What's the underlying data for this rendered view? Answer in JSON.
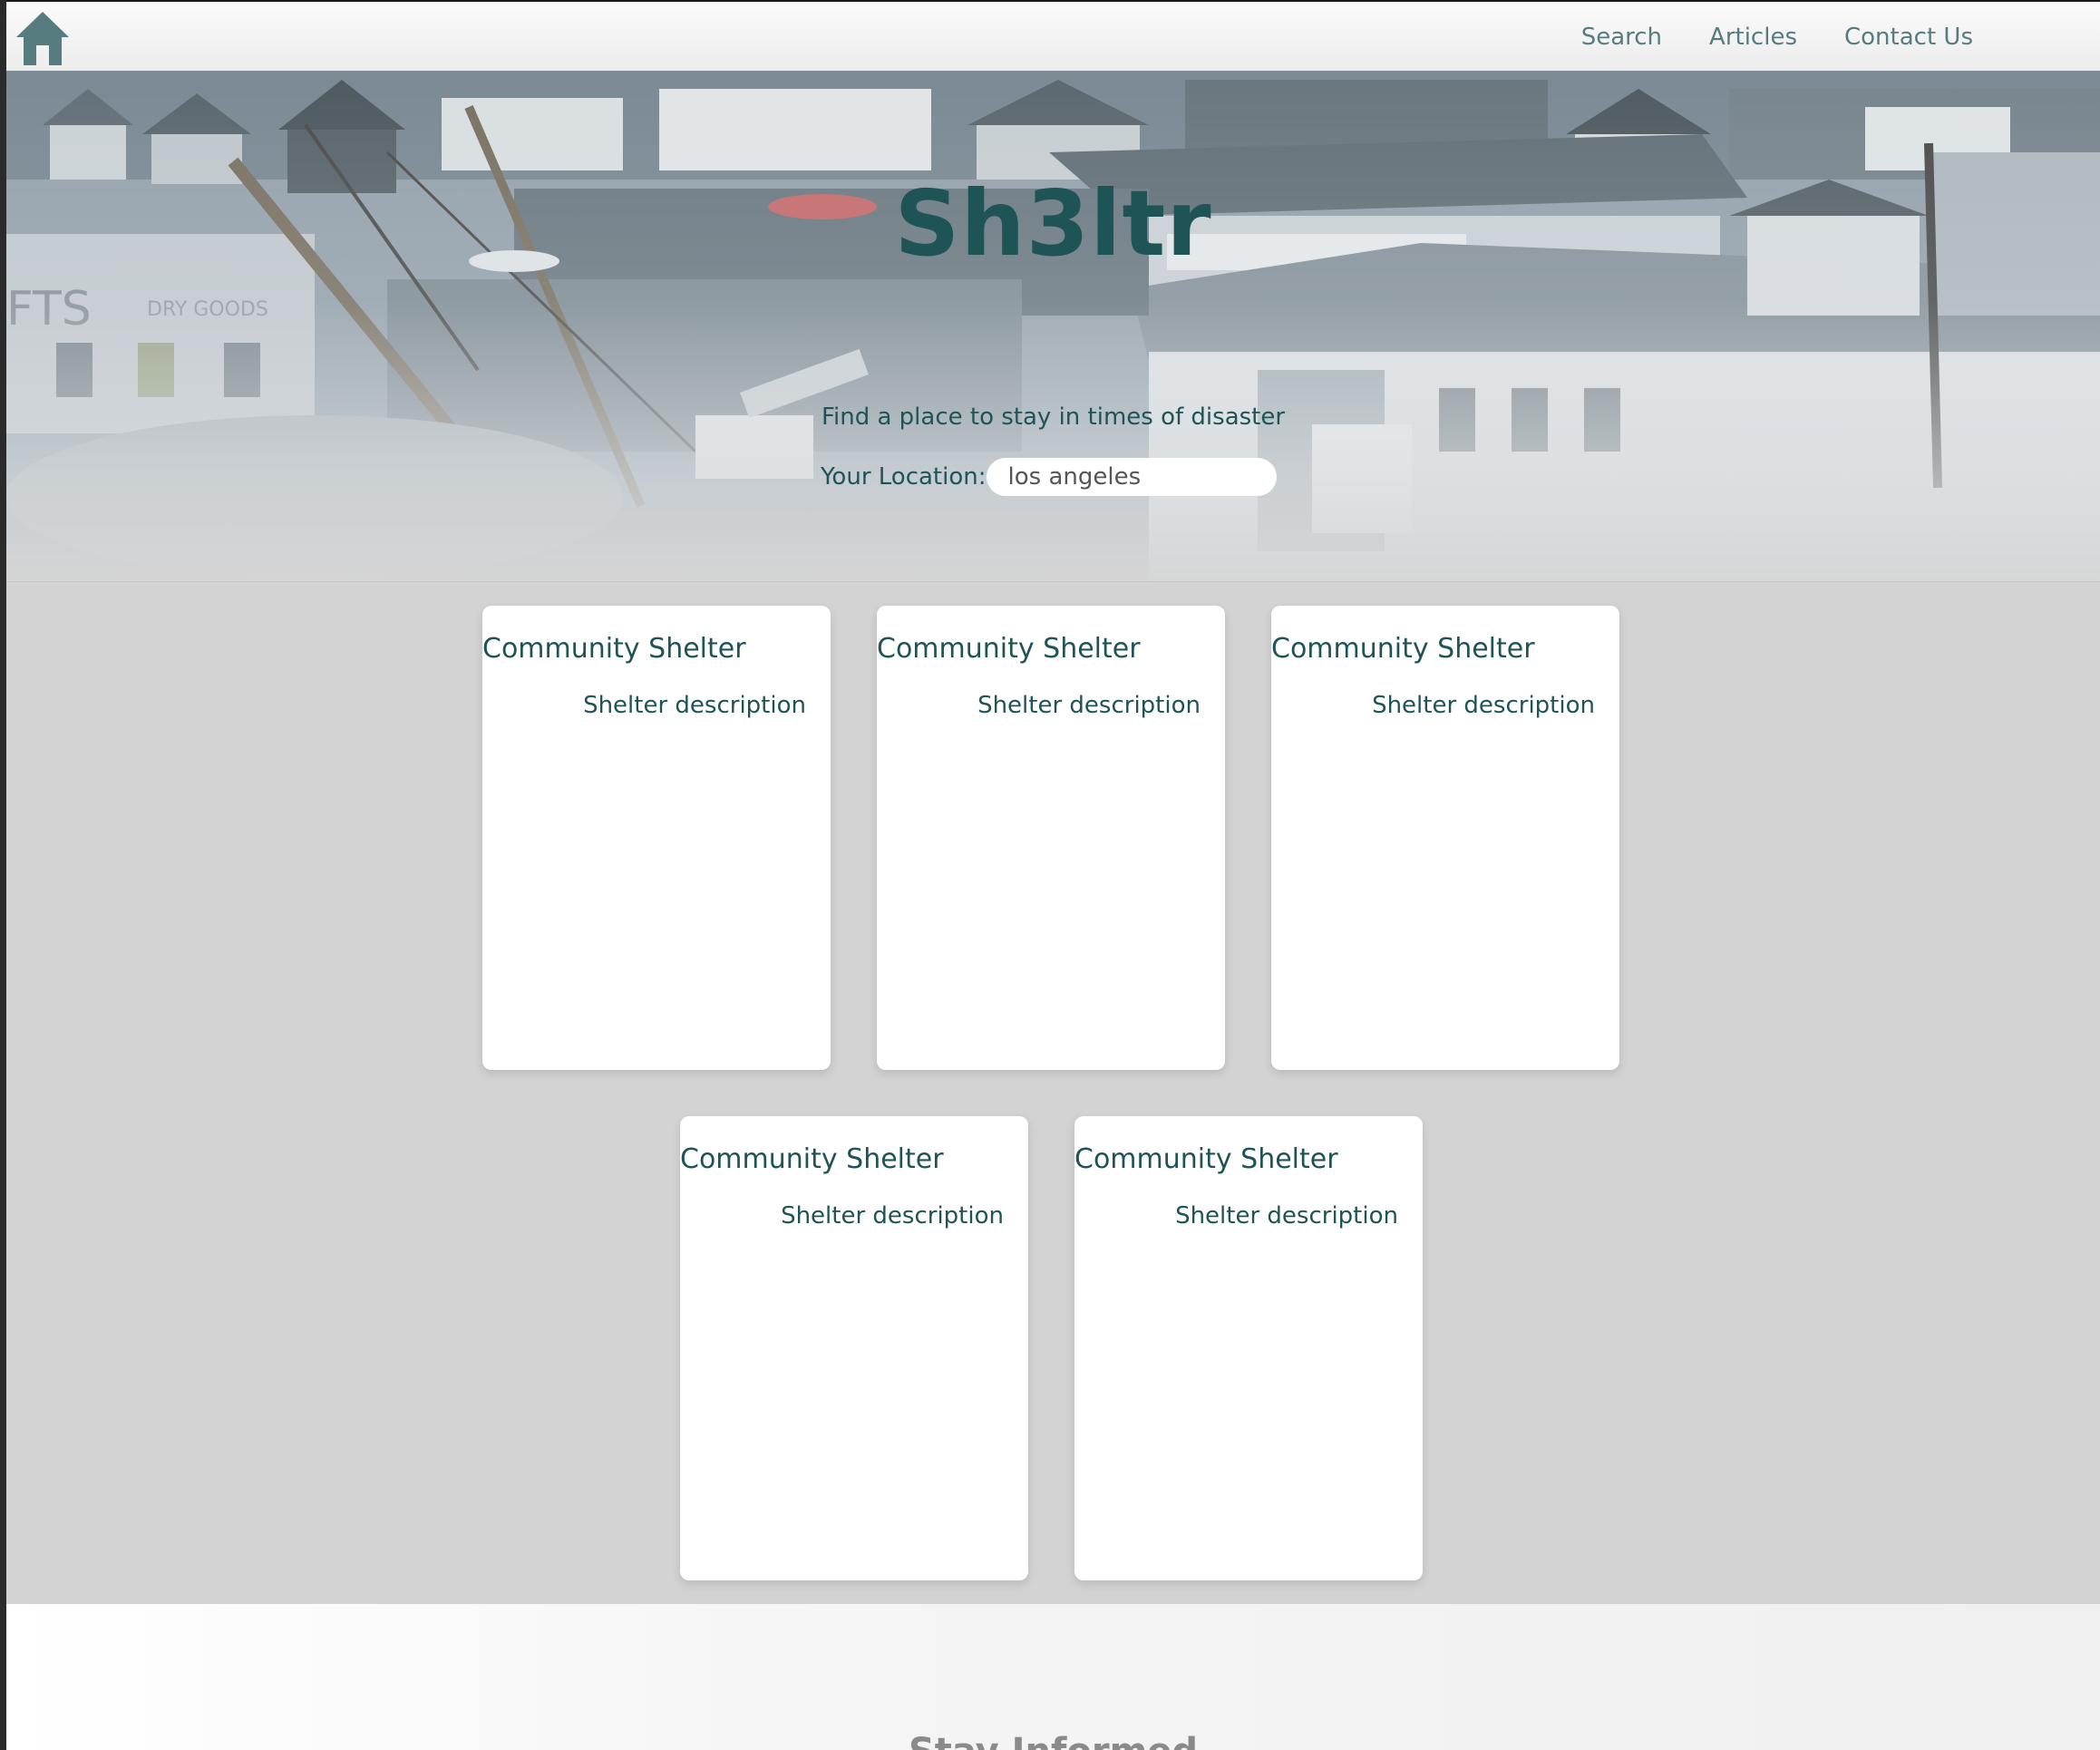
{
  "nav": {
    "home_icon": "home-icon",
    "links": [
      "Search",
      "Articles",
      "Contact Us"
    ]
  },
  "hero": {
    "title": "Sh3ltr",
    "tagline": "Find a place to stay in times of disaster",
    "location_label": "Your Location:",
    "location_value": "los angeles"
  },
  "shelters": [
    {
      "title": "Community Shelter",
      "description": "Shelter description"
    },
    {
      "title": "Community Shelter",
      "description": "Shelter description"
    },
    {
      "title": "Community Shelter",
      "description": "Shelter description"
    },
    {
      "title": "Community Shelter",
      "description": "Shelter description"
    },
    {
      "title": "Community Shelter",
      "description": "Shelter description"
    }
  ],
  "lower": {
    "heading": "Stay Informed"
  },
  "colors": {
    "brand": "#1f5456",
    "nav_link": "#567c80",
    "background": "#d3d3d3",
    "card": "#ffffff"
  }
}
